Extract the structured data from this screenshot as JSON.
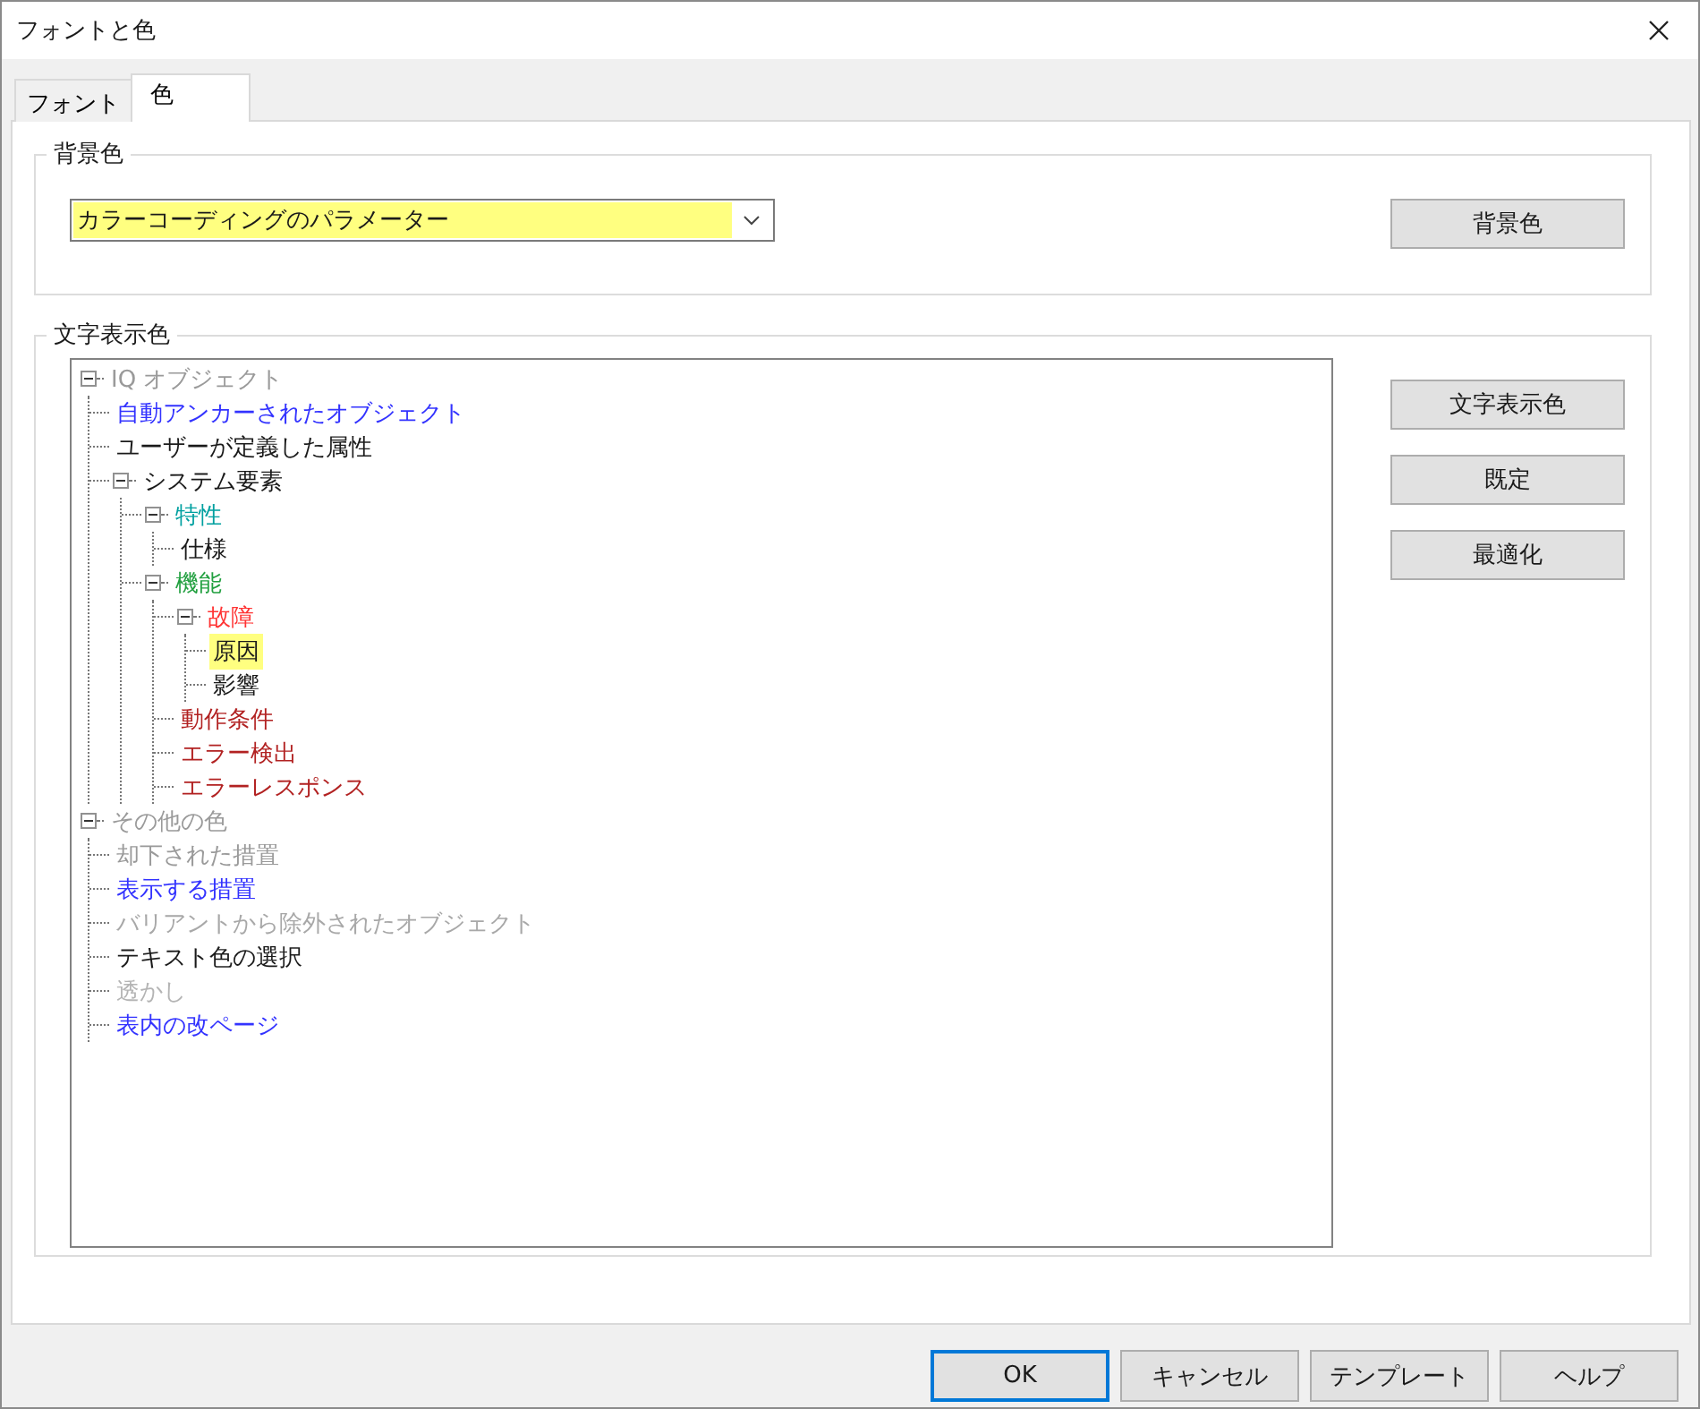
{
  "window": {
    "title": "フォントと色"
  },
  "tabs": [
    {
      "label": "フォント",
      "selected": false
    },
    {
      "label": "色",
      "selected": true
    }
  ],
  "background_group": {
    "title": "背景色",
    "combo_value": "カラーコーディングのパラメーター",
    "button": "背景色"
  },
  "text_group": {
    "title": "文字表示色",
    "buttons": [
      "文字表示色",
      "既定",
      "最適化"
    ],
    "tree": [
      {
        "label": "IQ オブジェクト",
        "color": "#9a9a9a",
        "selected": false,
        "expanded": true,
        "children": [
          {
            "label": "自動アンカーされたオブジェクト",
            "color": "#3333ff",
            "selected": false
          },
          {
            "label": "ユーザーが定義した属性",
            "color": "#1a1a1a",
            "selected": false
          },
          {
            "label": "システム要素",
            "color": "#1a1a1a",
            "selected": false,
            "expanded": true,
            "children": [
              {
                "label": "特性",
                "color": "#00a0a0",
                "selected": false,
                "expanded": true,
                "children": [
                  {
                    "label": "仕様",
                    "color": "#1a1a1a",
                    "selected": false
                  }
                ]
              },
              {
                "label": "機能",
                "color": "#22a040",
                "selected": false,
                "expanded": true,
                "children": [
                  {
                    "label": "故障",
                    "color": "#ff3333",
                    "selected": false,
                    "expanded": true,
                    "children": [
                      {
                        "label": "原因",
                        "selected": true
                      },
                      {
                        "label": "影響",
                        "color": "#1a1a1a",
                        "selected": false
                      }
                    ]
                  },
                  {
                    "label": "動作条件",
                    "color": "#b22222",
                    "selected": false
                  },
                  {
                    "label": "エラー検出",
                    "color": "#b22222",
                    "selected": false
                  },
                  {
                    "label": "エラーレスポンス",
                    "color": "#b22222",
                    "selected": false
                  }
                ]
              }
            ]
          }
        ]
      },
      {
        "label": "その他の色",
        "color": "#9a9a9a",
        "selected": false,
        "expanded": true,
        "children": [
          {
            "label": "却下された措置",
            "color": "#9a9a9a",
            "selected": false
          },
          {
            "label": "表示する措置",
            "color": "#3333ff",
            "selected": false
          },
          {
            "label": "バリアントから除外されたオブジェクト",
            "color": "#a8a8a8",
            "selected": false
          },
          {
            "label": "テキスト色の選択",
            "color": "#1a1a1a",
            "selected": false
          },
          {
            "label": "透かし",
            "color": "#b4b4b4",
            "selected": false
          },
          {
            "label": "表内の改ページ",
            "color": "#3333ff",
            "selected": false
          }
        ]
      }
    ]
  },
  "buttons": [
    {
      "label": "OK",
      "default": true
    },
    {
      "label": "キャンセル",
      "default": false
    },
    {
      "label": "テンプレート",
      "default": false
    },
    {
      "label": "ヘルプ",
      "default": false
    }
  ]
}
